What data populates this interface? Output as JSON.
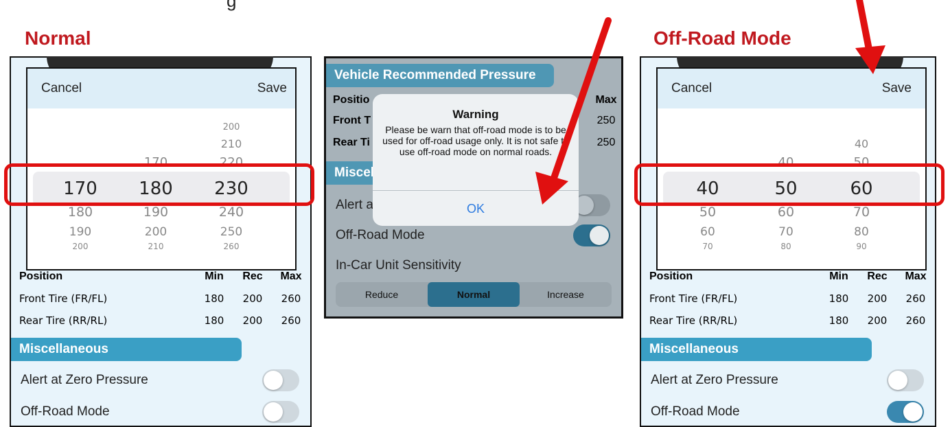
{
  "captions": {
    "left": "Normal",
    "right": "Off-Road Mode"
  },
  "picker": {
    "cancel": "Cancel",
    "save": "Save"
  },
  "left_wheel": {
    "col1": [
      "170",
      "180",
      "190",
      "200"
    ],
    "col2": [
      "170",
      "180",
      "190",
      "200",
      "210"
    ],
    "col3": [
      "200",
      "210",
      "220",
      "230",
      "240",
      "250",
      "260"
    ],
    "selected": [
      "170",
      "180",
      "230"
    ]
  },
  "right_wheel": {
    "col2": [
      "40",
      "50",
      "60",
      "70",
      "80"
    ],
    "col3": [
      "40",
      "50",
      "60",
      "70",
      "80",
      "90"
    ],
    "selected": [
      "40",
      "50",
      "60"
    ],
    "col1": [
      "40",
      "50",
      "60",
      "70"
    ]
  },
  "table": {
    "headers": [
      "Position",
      "Min",
      "Rec",
      "Max"
    ],
    "rows": [
      {
        "name": "Front Tire (FR/FL)",
        "min": "180",
        "rec": "200",
        "max": "260"
      },
      {
        "name": "Rear Tire (RR/RL)",
        "min": "180",
        "rec": "200",
        "max": "260"
      }
    ]
  },
  "misc": {
    "header": "Miscellaneous",
    "alert_zero": "Alert at Zero Pressure",
    "offroad": "Off-Road Mode",
    "sensitivity": "In-Car Unit Sensitivity"
  },
  "middle": {
    "section_title": "Vehicle Recommended Pressure",
    "position_short": "Positio",
    "front_short": "Front T",
    "rear_short": "Rear Ti",
    "max_head": "Max",
    "front_max": "250",
    "rear_max": "250",
    "misc_short": "Miscel",
    "alert_short": "Alert a",
    "dialog_title": "Warning",
    "dialog_message": "Please be warn that off-road mode is to be used for off-road usage only. It is not safe to use off-road mode on normal roads.",
    "ok": "OK",
    "seg": [
      "Reduce",
      "Normal",
      "Increase"
    ]
  },
  "colors": {
    "accent": "#3a9fc5",
    "red": "#e01010"
  },
  "toggles": {
    "left_alert": false,
    "left_offroad": false,
    "mid_offroad": true,
    "right_alert": false,
    "right_offroad": true
  }
}
